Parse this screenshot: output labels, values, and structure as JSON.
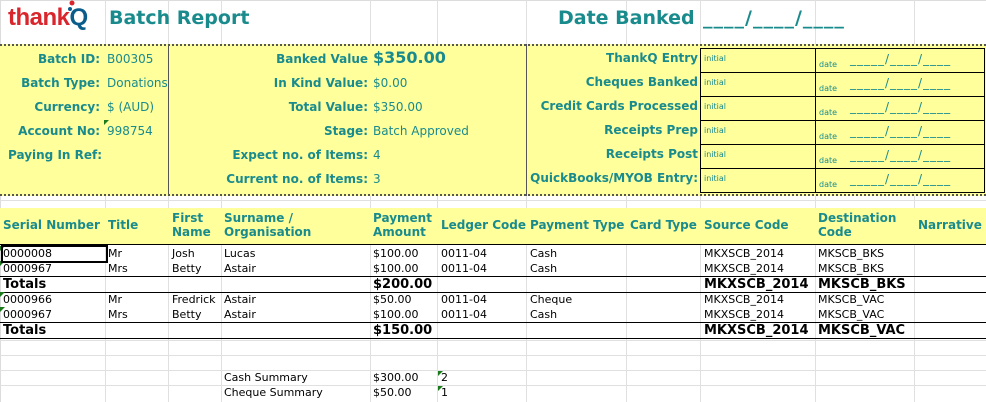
{
  "header": {
    "logo_text_a": "thank",
    "logo_text_b": "Q",
    "title": "Batch Report",
    "date_banked_label": "Date Banked",
    "date_banked_blank": "____/____/____"
  },
  "batch": {
    "batch_id_label": "Batch ID:",
    "batch_id": "B00305",
    "batch_type_label": "Batch Type:",
    "batch_type": "Donations",
    "currency_label": "Currency:",
    "currency": "$ (AUD)",
    "account_label": "Account No:",
    "account": "998754",
    "paying_in_label": "Paying In Ref:"
  },
  "values": {
    "banked_label": "Banked Value",
    "banked": "$350.00",
    "in_kind_label": "In Kind Value:",
    "in_kind": "$0.00",
    "total_label": "Total Value:",
    "total": "$350.00",
    "stage_label": "Stage:",
    "stage": "Batch Approved",
    "expect_label": "Expect no. of Items:",
    "expect": "4",
    "current_label": "Current no. of Items:",
    "current": "3"
  },
  "checklist": {
    "initial_text": "initial",
    "date_text": "date",
    "date_blank": "_____/____/____",
    "items": [
      "ThankQ Entry",
      "Cheques Banked",
      "Credit Cards Processed",
      "Receipts Prep",
      "Receipts Post",
      "QuickBooks/MYOB Entry:"
    ]
  },
  "columns": {
    "serial": "Serial Number",
    "title": "Title",
    "first_a": "First",
    "first_b": "Name",
    "surname_a": "Surname /",
    "surname_b": "Organisation",
    "amount_a": "Payment",
    "amount_b": "Amount",
    "ledger": "Ledger Code",
    "ptype": "Payment Type",
    "ctype": "Card Type",
    "source": "Source Code",
    "dest_a": "Destination",
    "dest_b": "Code",
    "narrative": "Narrative"
  },
  "group1": [
    {
      "serial": "0000008",
      "title": "Mr",
      "first": "Josh",
      "surname": "Lucas",
      "amount": "$100.00",
      "ledger": "0011-04",
      "ptype": "Cash",
      "source": "MKXSCB_2014",
      "dest": "MKSCB_BKS"
    },
    {
      "serial": "0000967",
      "title": "Mrs",
      "first": "Betty",
      "surname": "Astair",
      "amount": "$100.00",
      "ledger": "0011-04",
      "ptype": "Cash",
      "source": "MKXSCB_2014",
      "dest": "MKSCB_BKS"
    }
  ],
  "totals1": {
    "label": "Totals",
    "amount": "$200.00",
    "source": "MKXSCB_2014",
    "dest": "MKSCB_BKS"
  },
  "group2": [
    {
      "serial": "0000966",
      "title": "Mr",
      "first": "Fredrick",
      "surname": "Astair",
      "amount": "$50.00",
      "ledger": "0011-04",
      "ptype": "Cheque",
      "source": "MKXSCB_2014",
      "dest": "MKSCB_VAC"
    },
    {
      "serial": "0000967",
      "title": "Mrs",
      "first": "Betty",
      "surname": "Astair",
      "amount": "$100.00",
      "ledger": "0011-04",
      "ptype": "Cash",
      "source": "MKXSCB_2014",
      "dest": "MKSCB_VAC"
    }
  ],
  "totals2": {
    "label": "Totals",
    "amount": "$150.00",
    "source": "MKXSCB_2014",
    "dest": "MKSCB_VAC"
  },
  "summary": [
    {
      "label": "Cash Summary",
      "amount": "$300.00",
      "count": "2"
    },
    {
      "label": "Cheque Summary",
      "amount": "$50.00",
      "count": "1"
    }
  ]
}
